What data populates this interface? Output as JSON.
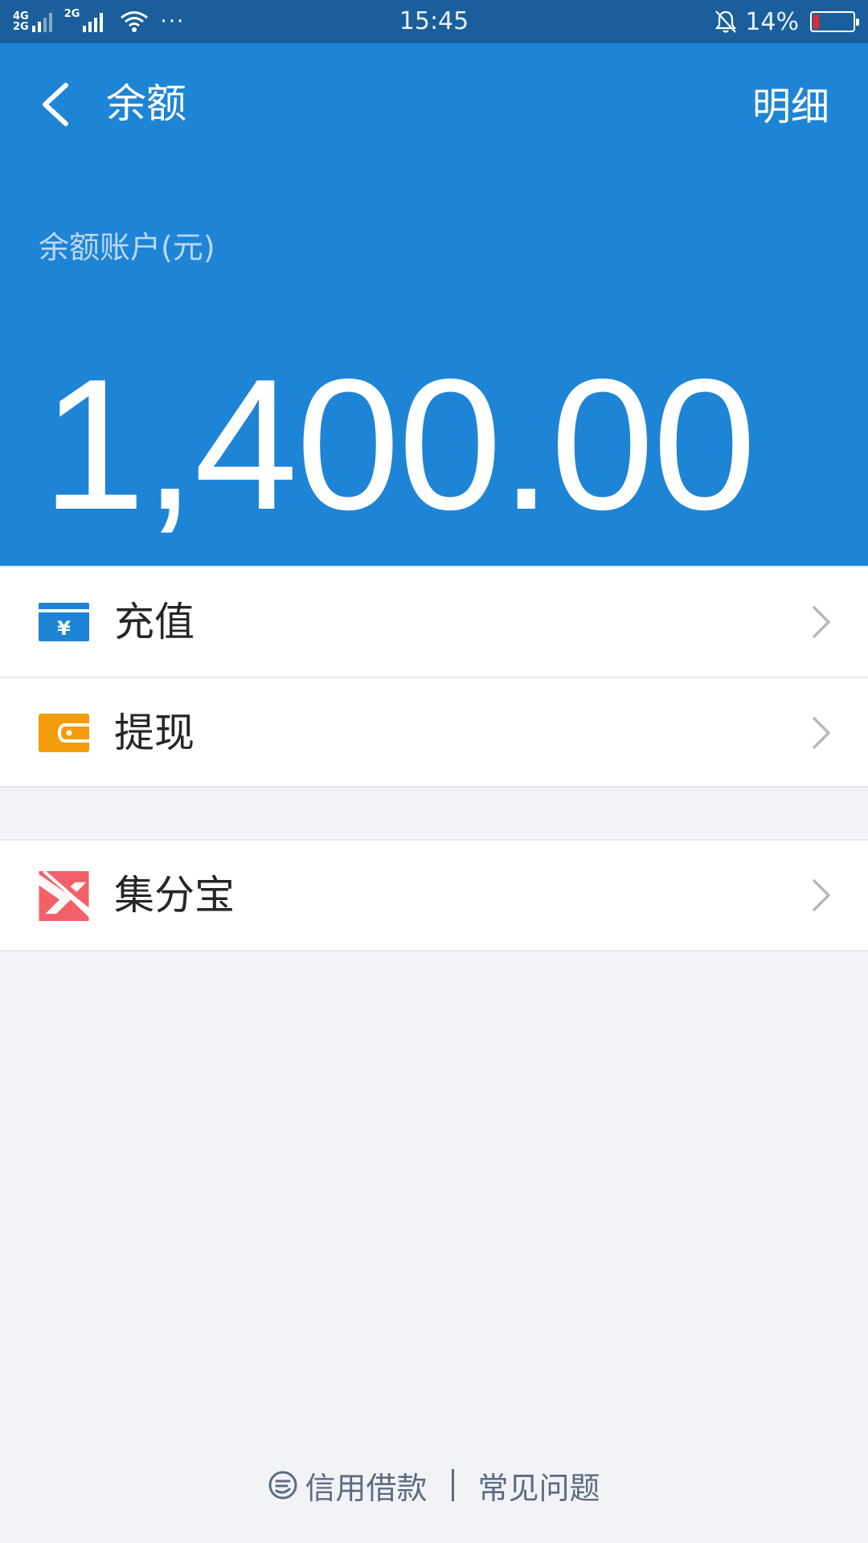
{
  "status_bar": {
    "network_1": [
      "4G",
      "2G"
    ],
    "network_2": "2G",
    "more_dots": "···",
    "time": "15:45",
    "battery_text": "14%",
    "battery_level": 0.14,
    "battery_color": "#e8282e"
  },
  "header": {
    "title": "余额",
    "detail_label": "明细",
    "balance_label": "余额账户(元)",
    "balance_amount": "1,400.00",
    "background": "#1e84d6"
  },
  "list": {
    "group_1": [
      {
        "label": "充值",
        "icon": "recharge-card-icon",
        "icon_color": "#1e84d6"
      },
      {
        "label": "提现",
        "icon": "wallet-icon",
        "icon_color": "#f39c0c"
      }
    ],
    "group_2": [
      {
        "label": "集分宝",
        "icon": "jifenbao-icon",
        "icon_color": "#f2606a"
      }
    ]
  },
  "footer": {
    "credit_loan": "信用借款",
    "separator": "|",
    "faq": "常见问题"
  }
}
